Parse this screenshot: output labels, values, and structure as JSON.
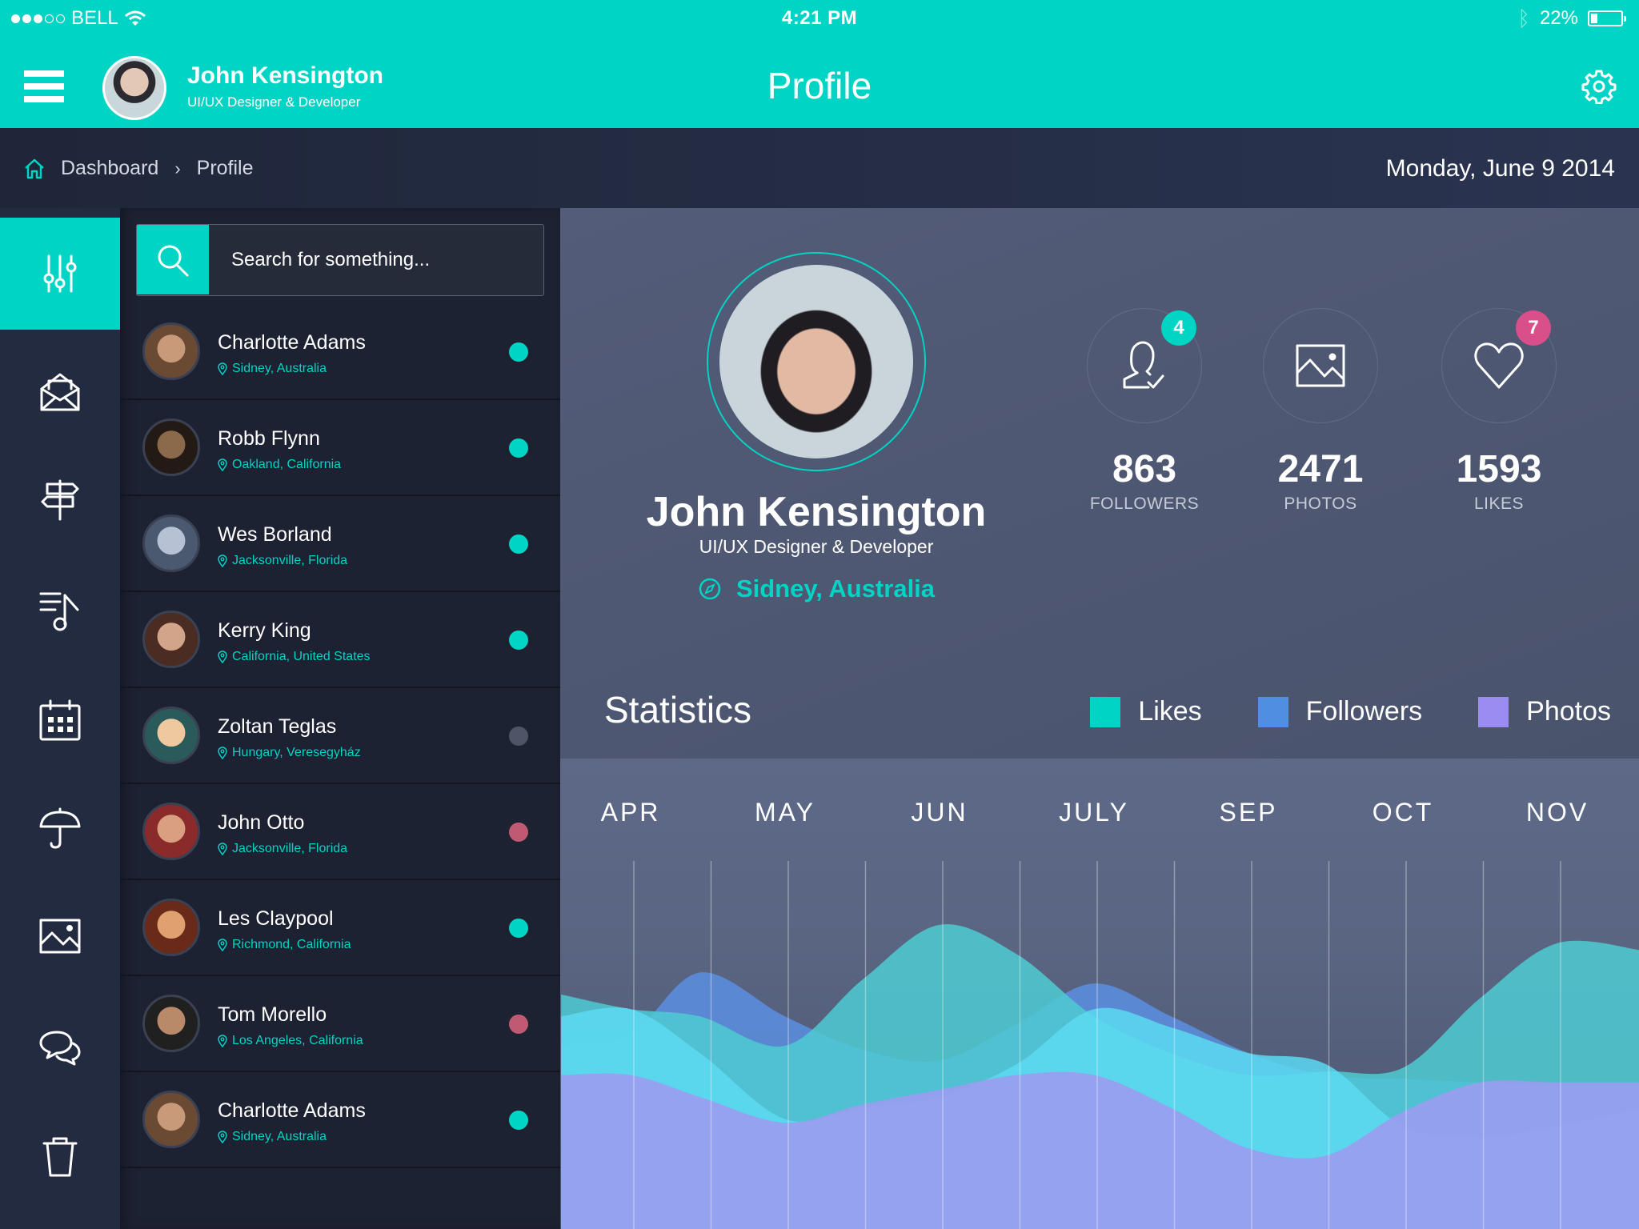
{
  "status_bar": {
    "carrier": "BELL",
    "signal_bars_filled": 3,
    "signal_bars_total": 5,
    "time": "4:21 PM",
    "battery_percent_label": "22%",
    "battery_level": 0.22
  },
  "header": {
    "user_name": "John Kensington",
    "user_role": "UI/UX Designer & Developer",
    "title": "Profile",
    "accent_color": "#00d4c4"
  },
  "breadcrumb": {
    "items": [
      "Dashboard",
      "Profile"
    ],
    "separator": "›"
  },
  "date": "Monday, June 9 2014",
  "sidebar": {
    "items": [
      {
        "icon": "sliders-icon",
        "active": true
      },
      {
        "icon": "open-mail-icon",
        "active": false
      },
      {
        "icon": "signpost-icon",
        "active": false
      },
      {
        "icon": "playlist-icon",
        "active": false
      },
      {
        "icon": "calendar-icon",
        "active": false
      },
      {
        "icon": "umbrella-icon",
        "active": false
      },
      {
        "icon": "image-icon",
        "active": false
      },
      {
        "icon": "chat-icon",
        "active": false
      },
      {
        "icon": "trash-icon",
        "active": false
      }
    ]
  },
  "search": {
    "placeholder": "Search for something..."
  },
  "contacts": [
    {
      "name": "Charlotte Adams",
      "location": "Sidney, Australia",
      "status": "online",
      "status_color": "#00d4c4"
    },
    {
      "name": "Robb Flynn",
      "location": "Oakland, California",
      "status": "online",
      "status_color": "#00d4c4"
    },
    {
      "name": "Wes Borland",
      "location": "Jacksonville, Florida",
      "status": "online",
      "status_color": "#00d4c4"
    },
    {
      "name": "Kerry King",
      "location": "California, United States",
      "status": "online",
      "status_color": "#00d4c4"
    },
    {
      "name": "Zoltan Teglas",
      "location": "Hungary, Veresegyház",
      "status": "offline",
      "status_color": "#4d5566"
    },
    {
      "name": "John Otto",
      "location": "Jacksonville, Florida",
      "status": "busy",
      "status_color": "#c05a72"
    },
    {
      "name": "Les Claypool",
      "location": "Richmond, California",
      "status": "online",
      "status_color": "#00d4c4"
    },
    {
      "name": "Tom Morello",
      "location": "Los Angeles, California",
      "status": "busy",
      "status_color": "#c05a72"
    },
    {
      "name": "Charlotte Adams",
      "location": "Sidney, Australia",
      "status": "online",
      "status_color": "#00d4c4"
    }
  ],
  "profile": {
    "name": "John Kensington",
    "role": "UI/UX Designer & Developer",
    "location": "Sidney, Australia",
    "stats": [
      {
        "key": "followers",
        "icon": "user-check-icon",
        "value": "863",
        "label": "FOLLOWERS",
        "badge": "4",
        "badge_color": "#00d4c4"
      },
      {
        "key": "photos",
        "icon": "image-icon",
        "value": "2471",
        "label": "PHOTOS",
        "badge": null,
        "badge_color": null
      },
      {
        "key": "likes",
        "icon": "heart-icon",
        "value": "1593",
        "label": "LIKES",
        "badge": "7",
        "badge_color": "#d94f8a"
      }
    ]
  },
  "statistics": {
    "title": "Statistics"
  },
  "chart_data": {
    "type": "area",
    "title": "Statistics",
    "categories": [
      "APR",
      "MAY",
      "JUN",
      "JULY",
      "SEP",
      "OCT",
      "NOV"
    ],
    "x_labels_position": "top",
    "grid": "vertical",
    "legend_position": "top-right",
    "ylim": [
      0,
      100
    ],
    "series": [
      {
        "name": "Likes",
        "color": "#4dc7d0",
        "x": [
          -0.45,
          0,
          0.45,
          1,
          1.5,
          2,
          2.5,
          3,
          3.5,
          4,
          4.5,
          5,
          5.5,
          6,
          6.55
        ],
        "values": [
          64,
          60,
          58,
          50,
          68,
          83,
          75,
          58,
          48,
          42,
          43,
          44,
          63,
          78,
          76
        ]
      },
      {
        "name": "Followers",
        "color": "#5b8fe0",
        "x": [
          -0.45,
          0,
          0.45,
          1,
          1.5,
          2,
          2.5,
          3,
          3.5,
          4,
          4.5,
          5,
          5.5,
          6,
          6.55
        ],
        "values": [
          50,
          53,
          70,
          58,
          49,
          46,
          56,
          67,
          58,
          48,
          42,
          41,
          40,
          39,
          39
        ],
        "note": "rendered behind cyan/likes layer"
      },
      {
        "name": "Photos",
        "color": "#9a97ee",
        "x": [
          -0.45,
          0,
          0.45,
          1,
          1.5,
          2,
          2.5,
          3,
          3.5,
          4,
          4.5,
          5,
          5.5,
          6,
          6.55
        ],
        "values": [
          42,
          42,
          36,
          29,
          34,
          38,
          42,
          42,
          33,
          22,
          20,
          32,
          40,
          40,
          40
        ]
      }
    ],
    "mid_layer": {
      "name": "Likes+Followers overlap",
      "color": "#59d8f0",
      "x": [
        -0.45,
        0,
        0.45,
        1,
        1.5,
        2,
        2.5,
        3,
        3.5,
        4,
        4.5,
        5,
        5.5,
        6,
        6.55
      ],
      "values": [
        58,
        60,
        48,
        30,
        33,
        36,
        45,
        60,
        55,
        48,
        45,
        28,
        25,
        28,
        33
      ]
    }
  }
}
